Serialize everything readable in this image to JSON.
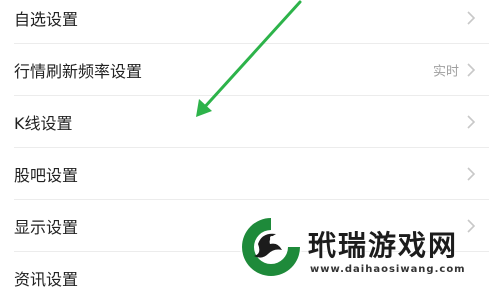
{
  "settings_list": {
    "items": [
      {
        "label": "自选设置",
        "value": "",
        "chevron": true
      },
      {
        "label": "行情刷新频率设置",
        "value": "实时",
        "chevron": true
      },
      {
        "label": "K线设置",
        "value": "",
        "chevron": true
      },
      {
        "label": "股吧设置",
        "value": "",
        "chevron": true
      },
      {
        "label": "显示设置",
        "value": "",
        "chevron": true
      },
      {
        "label": "资讯设置",
        "value": "",
        "chevron": true
      }
    ]
  },
  "annotation": {
    "icon": "arrow-icon",
    "color": "#2db34a"
  },
  "watermark": {
    "title": "玳瑞游戏网",
    "url": "www.daihaosiwang.com",
    "logo_icon": "dragon-logo-icon"
  },
  "colors": {
    "chevron": "#c8c8c8",
    "value_text": "#a0a0a0",
    "divider": "#ececec"
  }
}
